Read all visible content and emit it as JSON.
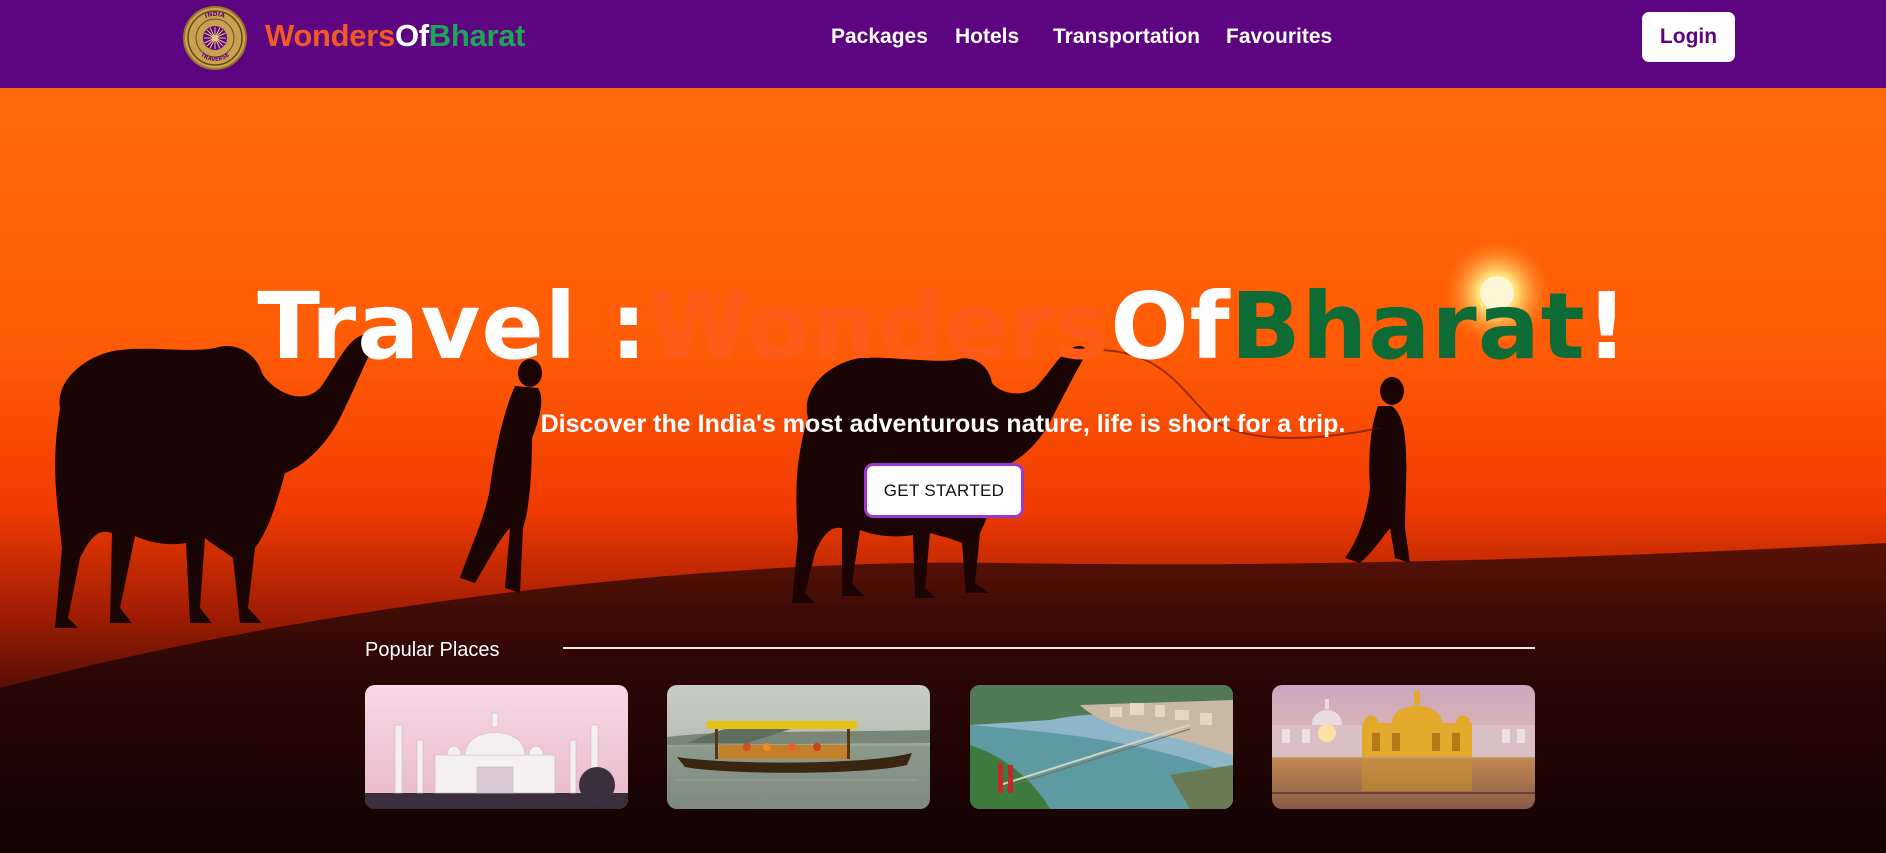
{
  "brand": {
    "name_part1": "Wonders",
    "name_part2": "Of",
    "name_part3": "Bharat",
    "badge_text_top": "INDIA",
    "badge_text_bottom": "TRAVERSE",
    "colors": {
      "saffron": "#f15a24",
      "white": "#ffffff",
      "green": "#1ea556"
    }
  },
  "nav": {
    "items": [
      {
        "label": "Packages"
      },
      {
        "label": "Hotels"
      },
      {
        "label": "Transportation"
      },
      {
        "label": "Favourites"
      }
    ],
    "login_label": "Login",
    "background": "#5d0480"
  },
  "hero": {
    "title_part1": "Travel :",
    "title_part2": "Wonders",
    "title_part3": "Of",
    "title_part4": "Bharat",
    "title_part5": "!",
    "subtitle": "Discover the India's most adventurous nature, life is short for a trip.",
    "cta_label": "GET STARTED",
    "scene": "desert-camels-sunset"
  },
  "popular": {
    "label": "Popular Places",
    "cards": [
      {
        "image": "taj-mahal-image"
      },
      {
        "image": "shikara-boat-lake-image"
      },
      {
        "image": "river-bridge-town-image"
      },
      {
        "image": "golden-temple-image"
      }
    ]
  }
}
